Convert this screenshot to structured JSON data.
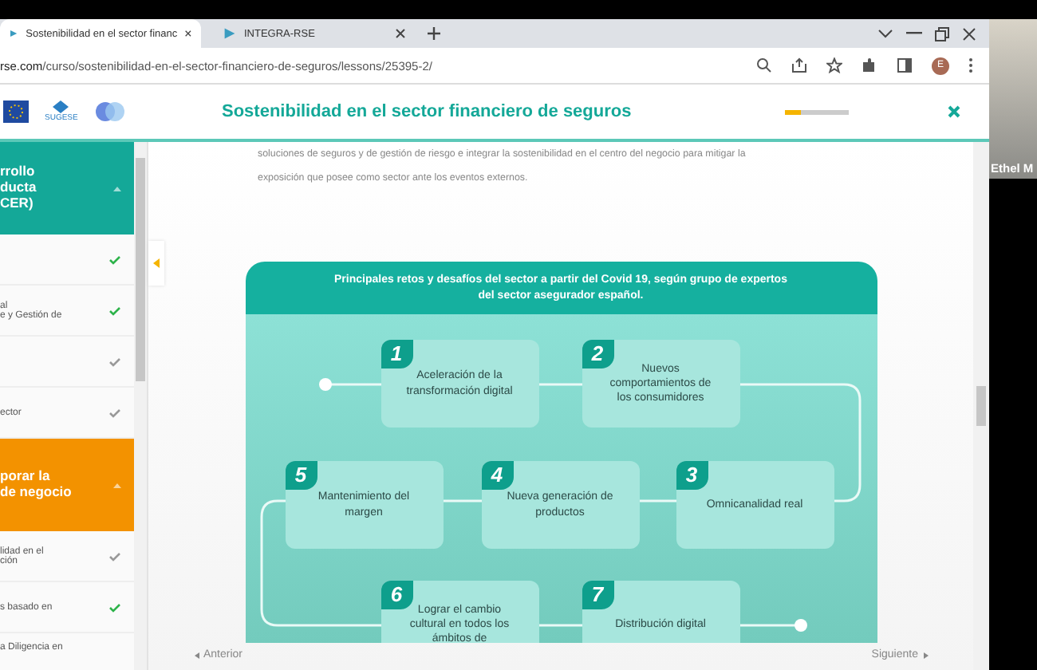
{
  "browser": {
    "tabs": [
      {
        "title": "Sostenibilidad en el sector financ",
        "selected": true
      },
      {
        "title": "INTEGRA-RSE",
        "selected": false
      }
    ],
    "url_host": "rse.com",
    "url_path": "/curso/sostenibilidad-en-el-sector-financiero-de-seguros/lessons/25395-2/",
    "profile": "E"
  },
  "header": {
    "title": "Sostenibilidad en el sector financiero de seguros",
    "logo_text": "SUGESE",
    "progress": {
      "level": 0.25
    }
  },
  "sidebar": {
    "sections": [
      {
        "title": "rrollo\nducta\nCER)",
        "kind": "teal",
        "items": [
          {
            "done": true
          },
          {
            "text": "al\ne y Gestión de",
            "done": true
          },
          {
            "done": false
          },
          {
            "text": "ector",
            "done": false
          }
        ]
      },
      {
        "title": "porar la\nde negocio",
        "kind": "orange",
        "items": [
          {
            "text": "lidad en el\nción",
            "done": false
          },
          {
            "text": "s basado en",
            "done": true
          },
          {
            "text": "a Diligencia en"
          }
        ]
      }
    ]
  },
  "content": {
    "intro": "soluciones de seguros y de gestión de riesgo e integrar la sostenibilidad en el centro del negocio para mitigar la exposición que posee como sector ante los eventos externos.",
    "diagram": {
      "title": "Principales retos y desafíos del sector a partir del Covid 19, según grupo de expertos del sector asegurador español.",
      "steps": [
        {
          "number": "1",
          "text": "Aceleración de la transformación digital"
        },
        {
          "number": "2",
          "text": "Nuevos comportamientos de los consumidores"
        },
        {
          "number": "5",
          "text": "Mantenimiento del margen"
        },
        {
          "number": "4",
          "text": "Nueva generación de productos"
        },
        {
          "number": "3",
          "text": "Omnicanalidad real"
        },
        {
          "number": "6",
          "text": "Lograr el cambio cultural en todos los ámbitos de"
        },
        {
          "number": "7",
          "text": "Distribución digital"
        }
      ]
    },
    "nav": {
      "prev": "Anterior",
      "next": "Siguiente"
    }
  },
  "video": {
    "name": "Ethel M"
  }
}
